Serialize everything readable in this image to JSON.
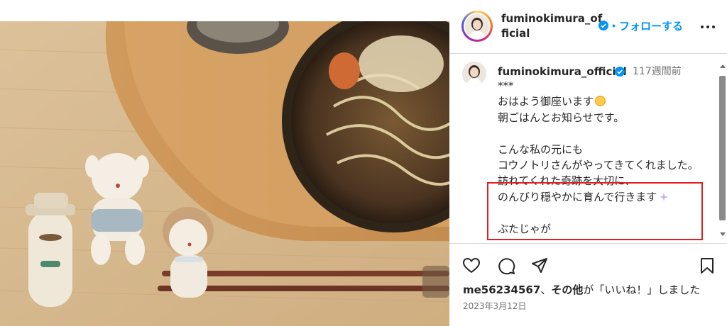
{
  "header": {
    "username": "fuminokimura_official",
    "follow_label": "・フォローする",
    "more_icon": "more-horizontal-icon"
  },
  "caption": {
    "username": "fuminokimura_official",
    "time_ago": "117週間前",
    "text_top": "***\nおはよう御座います",
    "text_mid": "\n朝ごはんとお知らせです。\n\nこんな私の元にも\nコウノトリさんがやってきてくれました。\n訪れてくれた奇跡を大切に、\nのんびり穏やかに育んで行きます",
    "text_bottom": "\n\nぶたじゃが"
  },
  "actions": {
    "like_icon": "heart-icon",
    "comment_icon": "comment-icon",
    "share_icon": "send-icon",
    "save_icon": "bookmark-icon"
  },
  "likes": {
    "user": "me56234567",
    "sep": "、",
    "others": "その他",
    "suffix": "が「いいね！」しました"
  },
  "date": "2023年3月12日",
  "colors": {
    "accent": "#0095f6",
    "verified": "#0095f6",
    "highlight": "#e02020",
    "wood": "#d8b98e"
  }
}
